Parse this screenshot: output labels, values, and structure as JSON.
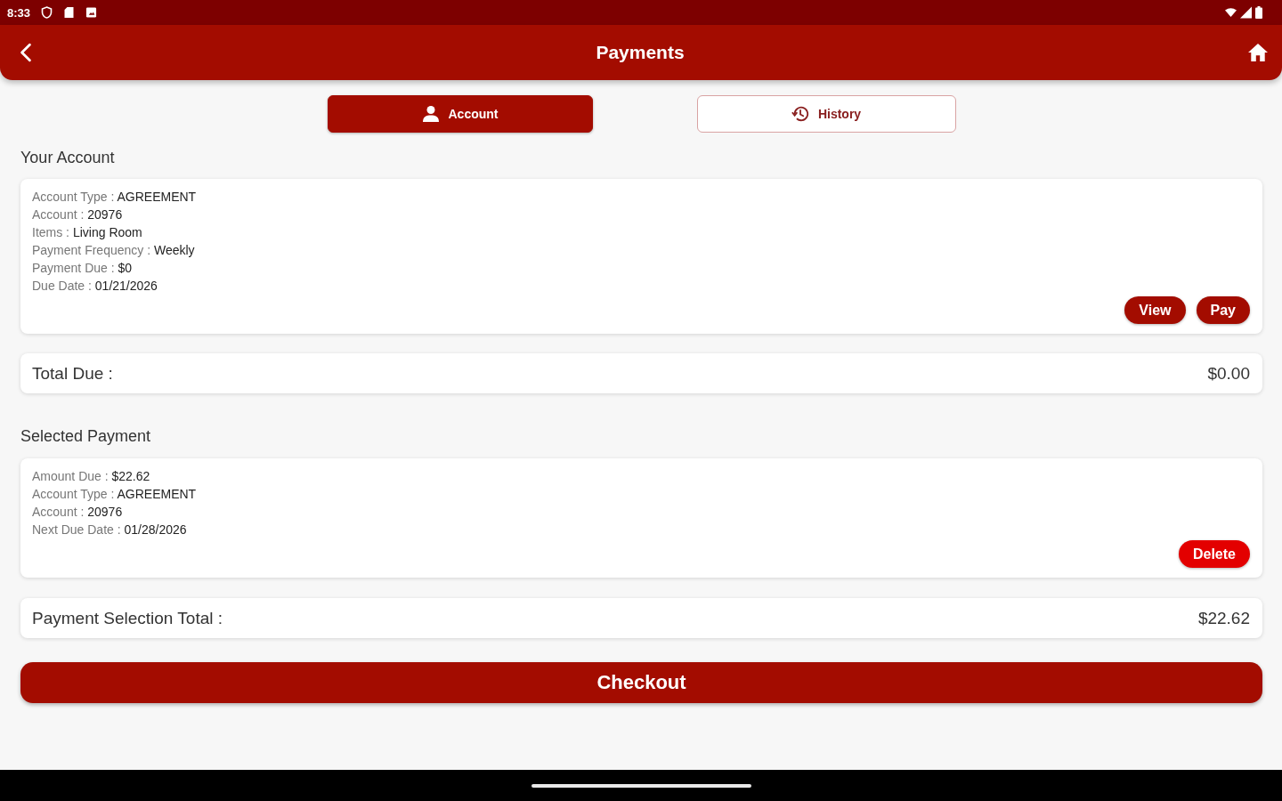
{
  "status_bar": {
    "time": "8:33"
  },
  "app_bar": {
    "title": "Payments"
  },
  "tabs": [
    {
      "label": "Account",
      "selected": true
    },
    {
      "label": "History",
      "selected": false
    }
  ],
  "account_section": {
    "heading": "Your Account",
    "details": [
      {
        "label": "Account Type :",
        "value": "AGREEMENT"
      },
      {
        "label": "Account :",
        "value": "20976"
      },
      {
        "label": "Items :",
        "value": "Living Room"
      },
      {
        "label": "Payment Frequency :",
        "value": "Weekly"
      },
      {
        "label": "Payment Due :",
        "value": "$0"
      },
      {
        "label": "Due Date :",
        "value": "01/21/2026"
      }
    ],
    "actions": [
      {
        "label": "View",
        "kind": "primary"
      },
      {
        "label": "Pay",
        "kind": "primary"
      }
    ]
  },
  "total_due": {
    "label": "Total Due :",
    "value": "$0.00"
  },
  "selected_section": {
    "heading": "Selected Payment",
    "details": [
      {
        "label": "Amount Due :",
        "value": "$22.62"
      },
      {
        "label": "Account Type :",
        "value": "AGREEMENT"
      },
      {
        "label": "Account :",
        "value": "20976"
      },
      {
        "label": "Next Due Date :",
        "value": "01/28/2026"
      }
    ],
    "actions": [
      {
        "label": "Delete",
        "kind": "danger"
      }
    ]
  },
  "selection_total": {
    "label": "Payment Selection Total :",
    "value": "$22.62"
  },
  "checkout_button": {
    "label": "Checkout"
  }
}
